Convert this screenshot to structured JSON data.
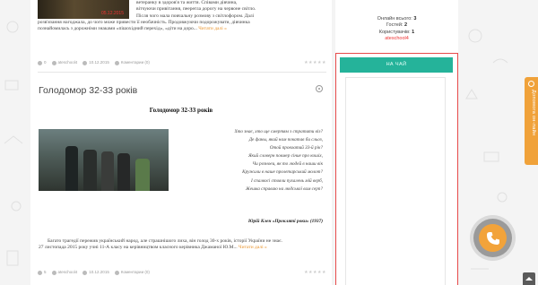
{
  "top_post": {
    "thumb_date": "05.12.2015",
    "lines": [
      "ветеранку в здоров'я та життя. Співами дівчина,",
      "вітчуючи привітання, пеерегла дорогу на червоне світло.",
      "Після чого мала повчальну розмову з світлофором. Далі",
      "розв'язання нагоджала, до чого може привести її необачність. Продовжуючи подорожувати, дівчинка",
      "познайомилась з дорожніми знаками «пішохідний перехід», «діти на доро..."
    ],
    "more_label": "Читати далі »",
    "meta": {
      "views": "0",
      "author": "ateschool4",
      "date": "10.12.2015",
      "comments": "Коментарии (0)"
    }
  },
  "post": {
    "title": "Голодомор 32-33 років",
    "heading": "Голодомор 32-33 років",
    "poem": [
      "Хто знає, хто ще смертям з стратити віз?",
      "Де фаны, який нам покатав би сльоз,",
      "Отой прокоатий 33-й рік?",
      "Який словерн повмер сіние про кошіх,",
      "Чи розноеи, як то людей в наши вік",
      "Кружили в наше пролетарський молот?",
      "І спалвосі стояли пухалень мій верб,",
      "Жешка справаю на людської вам серп?"
    ],
    "author": "Юрій Клен «Прокляті роки» (1937)",
    "paragraph": [
      "Багато трагедії пережив український народ, але страшнішого лиха, він голод 30-х років, історії України не знає.",
      "27 листопада 2015 року учні 11-А класу на керівництвом класного керівника Джаманої Ю.М..."
    ],
    "more_label": "Читати далі »",
    "meta": {
      "views": "5",
      "author": "ateschool4",
      "date": "10.12.2015",
      "comments": "Коментарии (0)"
    }
  },
  "sidebar": {
    "online_total_label": "Онлайн всього:",
    "online_total": "3",
    "guests_label": "Гостей:",
    "guests": "2",
    "users_label": "Користувачів:",
    "users": "1",
    "user_name": "ateschool4",
    "chat_title": "НА ЧАЙ"
  },
  "side_tab": {
    "label": "Допомога он-лайн"
  },
  "colors": {
    "accent": "#25b39a",
    "highlight": "#e74a4a",
    "orange": "#f2a33a"
  }
}
